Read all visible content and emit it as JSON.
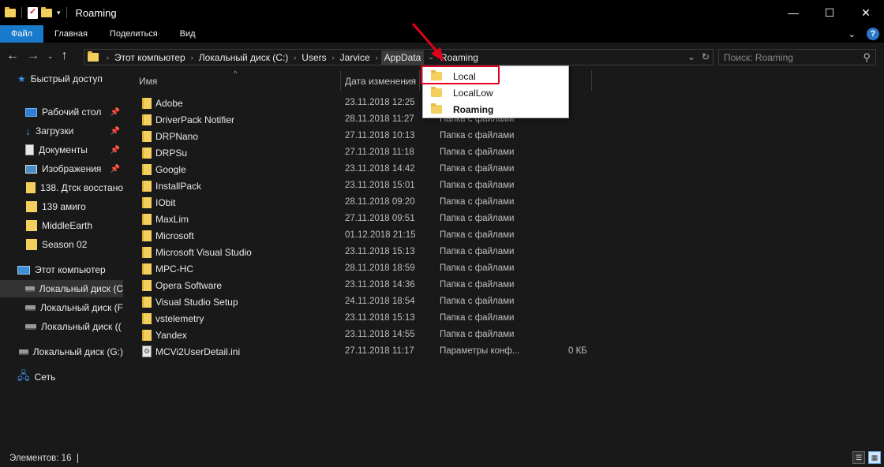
{
  "window": {
    "title": "Roaming",
    "minimize_glyph": "—",
    "maximize_glyph": "☐",
    "close_glyph": "✕"
  },
  "ribbon": {
    "tabs": [
      {
        "label": "Файл",
        "active": true
      },
      {
        "label": "Главная",
        "active": false
      },
      {
        "label": "Поделиться",
        "active": false
      },
      {
        "label": "Вид",
        "active": false
      }
    ],
    "expand_glyph": "⌄",
    "help_glyph": "?"
  },
  "nav": {
    "back_glyph": "←",
    "forward_glyph": "→",
    "recent_glyph": "⌄",
    "up_glyph": "↑"
  },
  "address": {
    "crumbs": [
      "Этот компьютер",
      "Локальный диск (C:)",
      "Users",
      "Jarvice",
      "AppData",
      "Roaming"
    ],
    "active_crumb": "AppData",
    "dropdown_glyph": "⌄",
    "refresh_glyph": "↻"
  },
  "search": {
    "placeholder": "Поиск: Roaming",
    "icon": "search-icon",
    "glyph": "⚲"
  },
  "sidebar": {
    "quick_access": "Быстрый доступ",
    "pinned": [
      "Рабочий стол",
      "Загрузки",
      "Документы",
      "Изображения"
    ],
    "recent_folders": [
      "138. Дтск восстано",
      "139 амиго",
      "MiddleEarth",
      "Season 02"
    ],
    "this_pc": "Этот компьютер",
    "drives": [
      "Локальный диск (C",
      "Локальный диск (F",
      "Локальный диск (("
    ],
    "drive_g": "Локальный диск (G:)",
    "network": "Сеть",
    "pin_glyph": "📌"
  },
  "columns": {
    "name": "Имя",
    "date": "Дата изменения",
    "sort_glyph": "^"
  },
  "files": [
    {
      "name": "Adobe",
      "date": "23.11.2018 12:25",
      "type": "",
      "size": "",
      "kind": "folder"
    },
    {
      "name": "DriverPack Notifier",
      "date": "28.11.2018 11:27",
      "type": "Папка с файлами",
      "size": "",
      "kind": "folder"
    },
    {
      "name": "DRPNano",
      "date": "27.11.2018 10:13",
      "type": "Папка с файлами",
      "size": "",
      "kind": "folder"
    },
    {
      "name": "DRPSu",
      "date": "27.11.2018 11:18",
      "type": "Папка с файлами",
      "size": "",
      "kind": "folder"
    },
    {
      "name": "Google",
      "date": "23.11.2018 14:42",
      "type": "Папка с файлами",
      "size": "",
      "kind": "folder"
    },
    {
      "name": "InstallPack",
      "date": "23.11.2018 15:01",
      "type": "Папка с файлами",
      "size": "",
      "kind": "folder"
    },
    {
      "name": "IObit",
      "date": "28.11.2018 09:20",
      "type": "Папка с файлами",
      "size": "",
      "kind": "folder"
    },
    {
      "name": "MaxLim",
      "date": "27.11.2018 09:51",
      "type": "Папка с файлами",
      "size": "",
      "kind": "folder"
    },
    {
      "name": "Microsoft",
      "date": "01.12.2018 21:15",
      "type": "Папка с файлами",
      "size": "",
      "kind": "folder"
    },
    {
      "name": "Microsoft Visual Studio",
      "date": "23.11.2018 15:13",
      "type": "Папка с файлами",
      "size": "",
      "kind": "folder"
    },
    {
      "name": "MPC-HC",
      "date": "28.11.2018 18:59",
      "type": "Папка с файлами",
      "size": "",
      "kind": "folder"
    },
    {
      "name": "Opera Software",
      "date": "23.11.2018 14:36",
      "type": "Папка с файлами",
      "size": "",
      "kind": "folder"
    },
    {
      "name": "Visual Studio Setup",
      "date": "24.11.2018 18:54",
      "type": "Папка с файлами",
      "size": "",
      "kind": "folder"
    },
    {
      "name": "vstelemetry",
      "date": "23.11.2018 15:13",
      "type": "Папка с файлами",
      "size": "",
      "kind": "folder"
    },
    {
      "name": "Yandex",
      "date": "23.11.2018 14:55",
      "type": "Папка с файлами",
      "size": "",
      "kind": "folder"
    },
    {
      "name": "MCVi2UserDetail.ini",
      "date": "27.11.2018 11:17",
      "type": "Параметры конф...",
      "size": "0 КБ",
      "kind": "file"
    }
  ],
  "dropdown": {
    "items": [
      {
        "label": "Local",
        "bold": false
      },
      {
        "label": "LocalLow",
        "bold": false
      },
      {
        "label": "Roaming",
        "bold": true
      }
    ],
    "highlight_color": "#e0001b"
  },
  "status": {
    "count": "Элементов: 16",
    "details_view_glyph": "☰",
    "tiles_view_glyph": "▦"
  },
  "colors": {
    "accent": "#1979ca",
    "background": "#191919",
    "folder": "#f3cf5d",
    "annotation": "#e0001b"
  }
}
